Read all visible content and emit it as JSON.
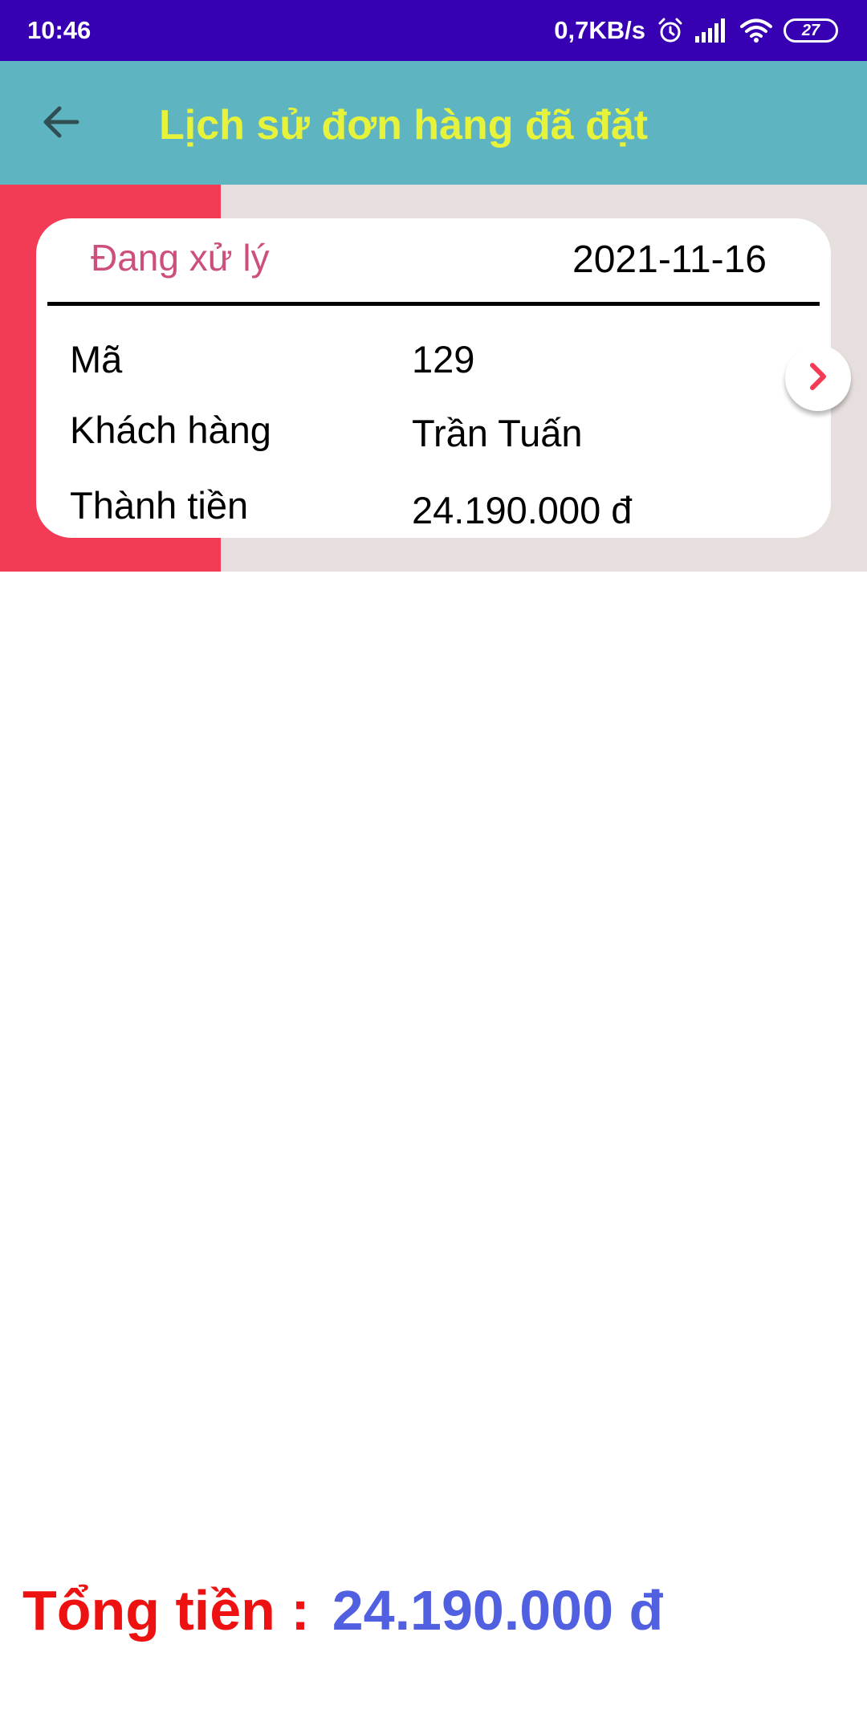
{
  "status_bar": {
    "time": "10:46",
    "network_speed": "0,7KB/s",
    "battery_level": "27",
    "icons": [
      "alarm-icon",
      "signal-icon",
      "wifi-icon",
      "battery-icon"
    ]
  },
  "app_bar": {
    "back_icon": "arrow-left-icon",
    "title": "Lịch sử đơn hàng đã đặt",
    "background_color": "#5fb4c1",
    "title_color": "#e6f33a"
  },
  "orders": [
    {
      "status": "Đang xử lý",
      "date": "2021-11-16",
      "fields": [
        {
          "label": "Mã",
          "value": "129"
        },
        {
          "label": "Khách hàng",
          "value": "Trần Tuấn"
        },
        {
          "label": "Thành tiền",
          "value": "24.190.000 đ"
        }
      ],
      "detail_icon": "chevron-right-icon",
      "accent_color": "#f43b56",
      "status_color": "#cc4f7e"
    }
  ],
  "footer": {
    "total_label": "Tổng tiền :",
    "total_value": "24.190.000 đ",
    "label_color": "#ee1111",
    "value_color": "#5160e0"
  }
}
